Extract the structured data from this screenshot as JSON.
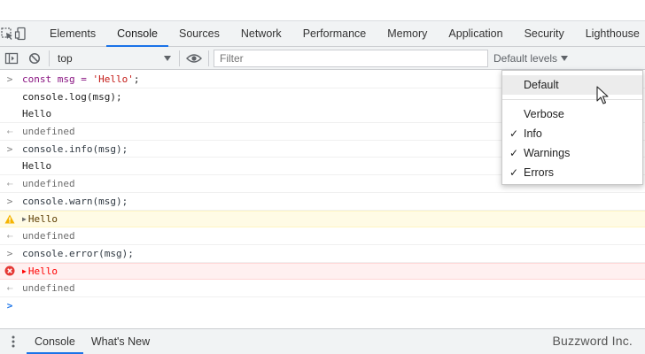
{
  "tabs": [
    "Elements",
    "Console",
    "Sources",
    "Network",
    "Performance",
    "Memory",
    "Application",
    "Security",
    "Lighthouse"
  ],
  "active_tab": "Console",
  "toolbar": {
    "context": "top",
    "filter_placeholder": "Filter",
    "levels_label": "Default levels"
  },
  "console": {
    "lines": [
      {
        "kind": "input",
        "text": "const msg = "
      },
      {
        "kind": "log",
        "text": "console.log(msg);"
      },
      {
        "kind": "log",
        "text": "Hello"
      },
      {
        "kind": "output",
        "text": "undefined"
      },
      {
        "kind": "input",
        "text": "console.info(msg);"
      },
      {
        "kind": "log",
        "text": "Hello"
      },
      {
        "kind": "output",
        "text": "undefined"
      },
      {
        "kind": "input",
        "text": "console.warn(msg);"
      },
      {
        "kind": "warn",
        "text": "Hello"
      },
      {
        "kind": "output",
        "text": "undefined"
      },
      {
        "kind": "input",
        "text": "console.error(msg);"
      },
      {
        "kind": "error",
        "text": "Hello"
      },
      {
        "kind": "output",
        "text": "undefined"
      }
    ],
    "first_input_string": "'Hello'",
    "first_input_tail": ";"
  },
  "levels_menu": {
    "items": [
      {
        "label": "Default",
        "checked": false,
        "hover": true
      },
      {
        "label": "Verbose",
        "checked": false
      },
      {
        "label": "Info",
        "checked": true
      },
      {
        "label": "Warnings",
        "checked": true
      },
      {
        "label": "Errors",
        "checked": true
      }
    ],
    "check_glyph": "✓"
  },
  "drawer": {
    "tabs": [
      "Console",
      "What's New"
    ],
    "active": "Console"
  },
  "watermark": "Buzzword Inc.",
  "colors": {
    "accent": "#1a73e8",
    "warn_bg": "#fffbe5",
    "error_bg": "#fff0f0",
    "error_text": "#ff0000",
    "string": "#c41a16"
  },
  "icons": {
    "inspect": "inspect-element-icon",
    "device": "device-toolbar-icon",
    "sidebar": "show-sidebar-icon",
    "clear": "clear-console-icon",
    "eye": "live-expression-icon",
    "warn": "warning-icon",
    "error": "error-icon",
    "drawer_menu": "more-vert-icon"
  }
}
